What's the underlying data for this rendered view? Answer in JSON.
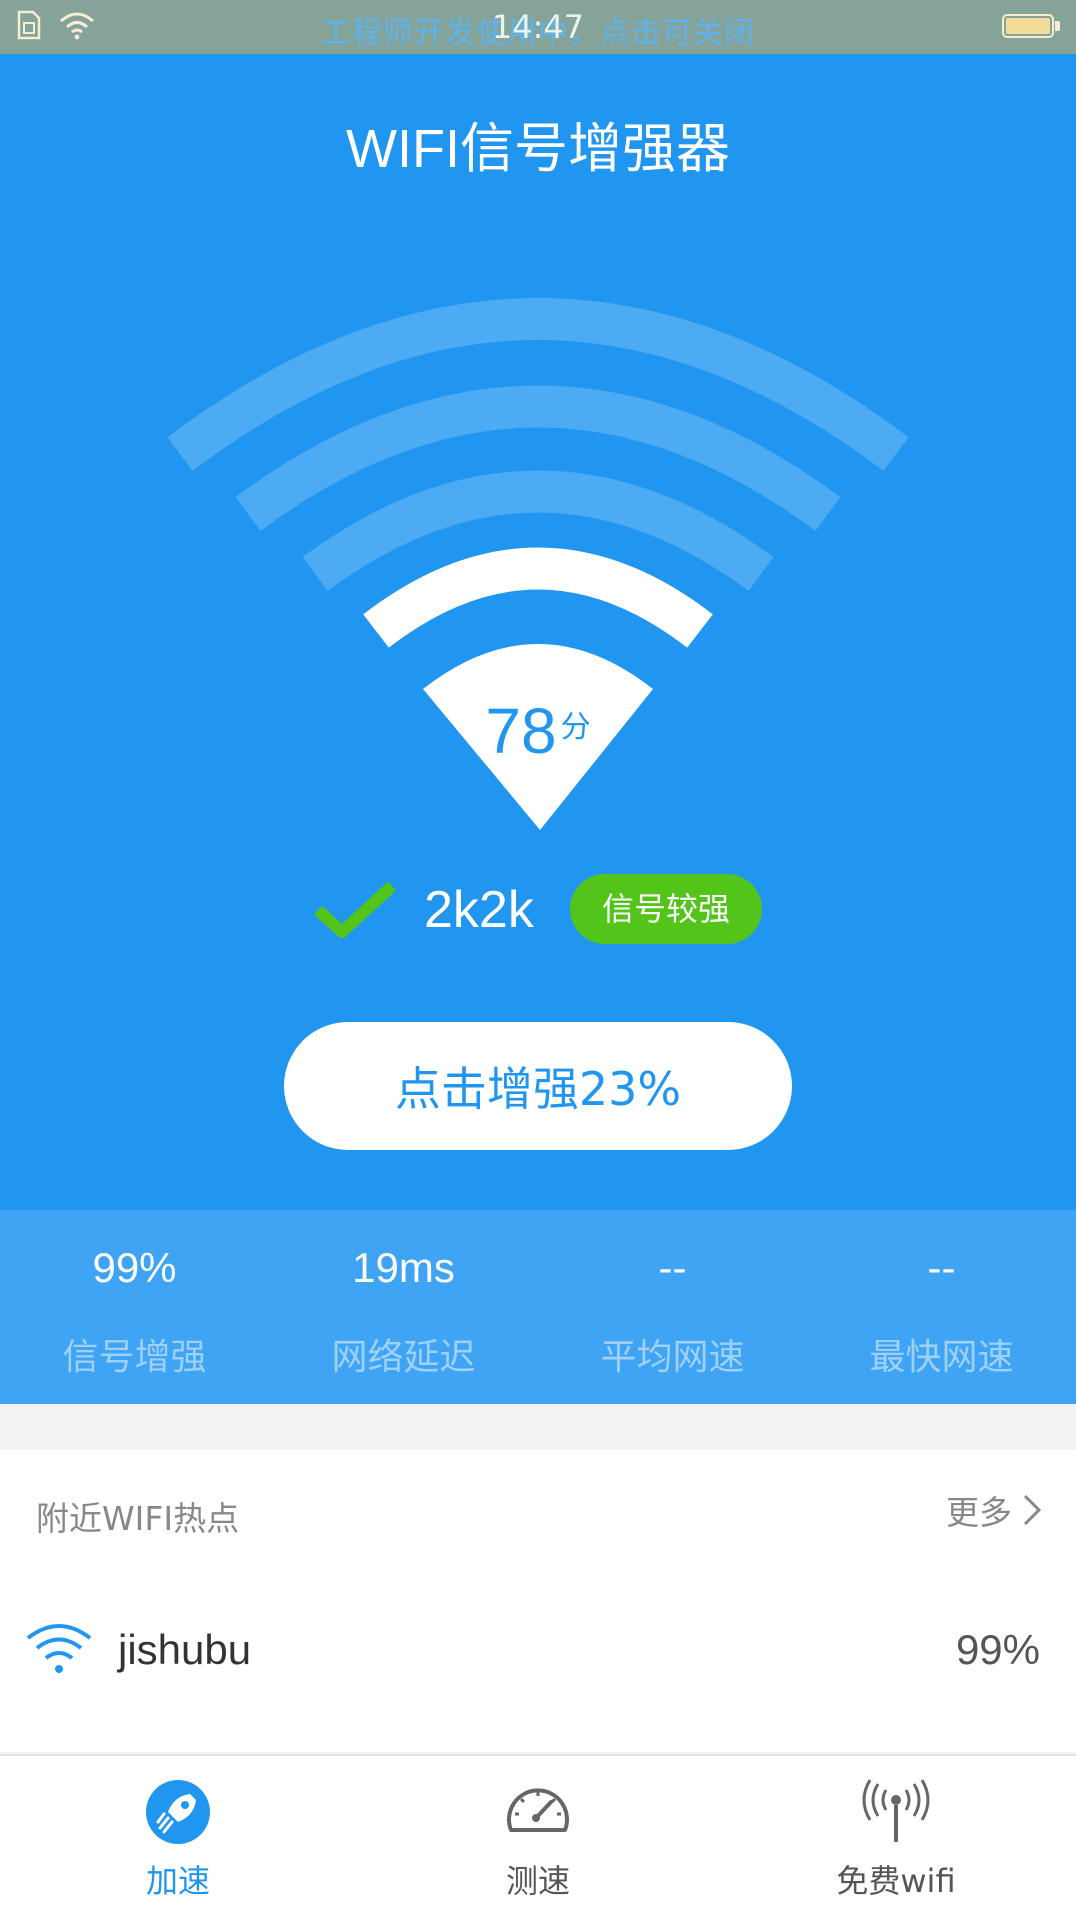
{
  "status_bar": {
    "time": "14:47",
    "developer_notice": "工程师开发使用中，点击可关闭"
  },
  "header": {
    "title": "WIFI信号增强器"
  },
  "score": {
    "value": "78",
    "unit": "分"
  },
  "connection": {
    "ssid": "2k2k",
    "signal_label": "信号较强"
  },
  "boost_button": {
    "label": "点击增强23%"
  },
  "stats": [
    {
      "value": "99%",
      "label": "信号增强"
    },
    {
      "value": "19ms",
      "label": "网络延迟"
    },
    {
      "value": "--",
      "label": "平均网速"
    },
    {
      "value": "--",
      "label": "最快网速"
    }
  ],
  "nearby": {
    "title": "附近WIFI热点",
    "more_label": "更多",
    "networks": [
      {
        "ssid": "jishubu",
        "strength": "99%"
      }
    ]
  },
  "tabs": [
    {
      "label": "加速",
      "icon": "rocket-icon",
      "active": true
    },
    {
      "label": "测速",
      "icon": "speedometer-icon",
      "active": false
    },
    {
      "label": "免费wifi",
      "icon": "antenna-icon",
      "active": false
    }
  ],
  "colors": {
    "primary": "#2196f0",
    "stats_bg": "#3fa4f3",
    "badge_green": "#52c41a",
    "status_bar_bg": "#85a398"
  }
}
